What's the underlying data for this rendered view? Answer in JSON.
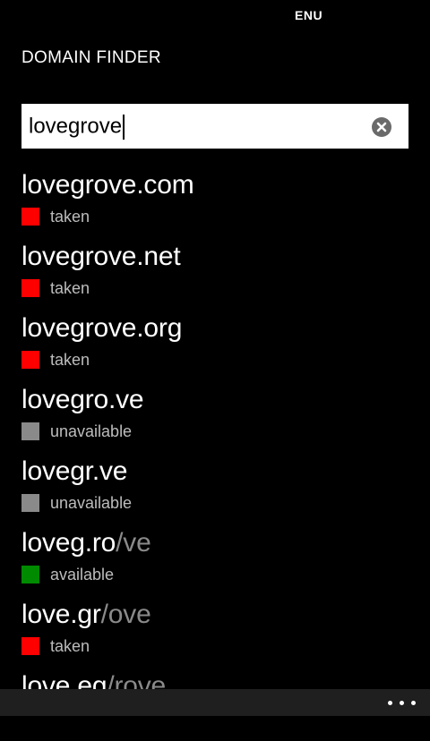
{
  "status_bar": {
    "language": "ENU"
  },
  "app": {
    "title": "DOMAIN FINDER"
  },
  "search": {
    "value": "lovegrove",
    "clear_icon": "close-circle-icon"
  },
  "status_colors": {
    "taken": "#ff0000",
    "unavailable": "#8a8a8a",
    "available": "#008a00"
  },
  "results": [
    {
      "domain": "lovegrove.com",
      "suffix": "",
      "status": "taken"
    },
    {
      "domain": "lovegrove.net",
      "suffix": "",
      "status": "taken"
    },
    {
      "domain": "lovegrove.org",
      "suffix": "",
      "status": "taken"
    },
    {
      "domain": "lovegro.ve",
      "suffix": "",
      "status": "unavailable"
    },
    {
      "domain": "lovegr.ve",
      "suffix": "",
      "status": "unavailable"
    },
    {
      "domain": "loveg.ro",
      "suffix": "/ve",
      "status": "available"
    },
    {
      "domain": "love.gr",
      "suffix": "/ove",
      "status": "taken"
    },
    {
      "domain": "love.eg",
      "suffix": "/rove",
      "status": ""
    }
  ],
  "app_bar": {
    "more_icon": "ellipsis-icon"
  }
}
